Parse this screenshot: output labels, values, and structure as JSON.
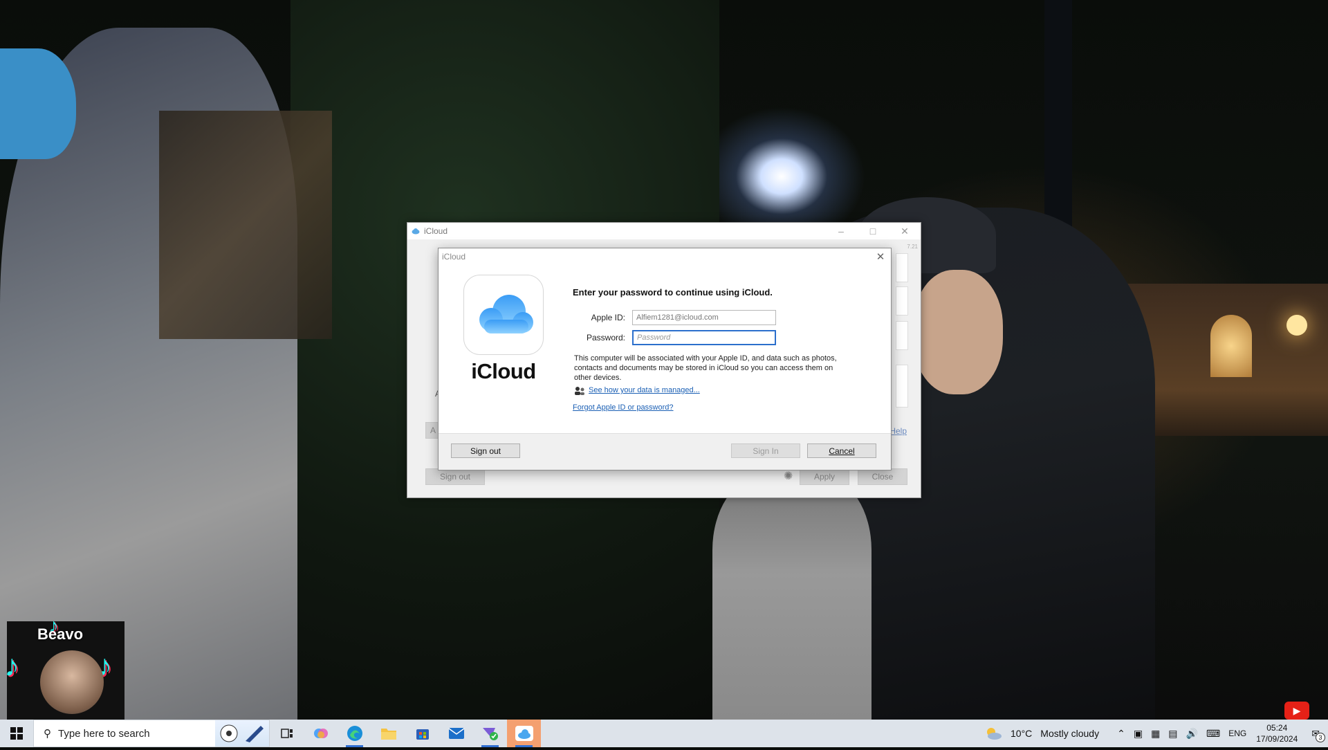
{
  "back_window": {
    "title": "iCloud",
    "version": "7.21",
    "sign_out_label": "Sign out",
    "apply_label": "Apply",
    "close_label": "Close",
    "help_label": "Help",
    "partial_letter_a": "A",
    "partial_label_a": "A"
  },
  "dialog": {
    "title": "iCloud",
    "logo_text": "iCloud",
    "heading": "Enter your password to continue using iCloud.",
    "apple_id_label": "Apple ID:",
    "apple_id_value": "Alfiem1281@icloud.com",
    "password_label": "Password:",
    "password_placeholder": "Password",
    "description": "This computer will be associated with your Apple ID, and data such as photos, contacts and documents may be stored in iCloud so you can access them on other devices.",
    "data_link": "See how your data is managed...",
    "forgot_link": "Forgot Apple ID or password?",
    "sign_out_label": "Sign out",
    "sign_in_label": "Sign In",
    "cancel_label": "Cancel"
  },
  "overlay": {
    "tiktok_name": "Beavo"
  },
  "taskbar": {
    "search_placeholder": "Type here to search",
    "weather_temp": "10°C",
    "weather_desc": "Mostly cloudy",
    "language": "ENG",
    "time": "05:24",
    "date": "17/09/2024",
    "notification_count": "3"
  },
  "colors": {
    "link": "#1a5fb4",
    "focus_border": "#2b6fcc",
    "taskbar_bg": "#dde3ea",
    "active_app": "#f4a070"
  }
}
